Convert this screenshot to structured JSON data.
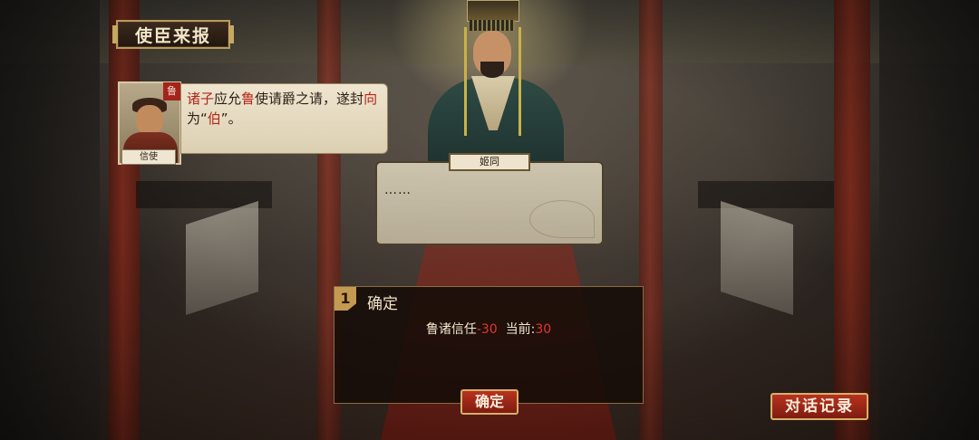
{
  "banner": {
    "title": "使臣来报"
  },
  "envoy": {
    "seal": "鲁",
    "name": "信使",
    "message": {
      "part1": "诸子",
      "part2": "应允",
      "part3": "鲁",
      "part4": "使请爵之请，遂封",
      "part5": "向",
      "part6": "为“",
      "part7": "伯",
      "part8": "”。"
    }
  },
  "king": {
    "name": "姬同",
    "dialogue": "……"
  },
  "choice": {
    "number": "1",
    "title": "确定",
    "effect_label": "鲁诸信任",
    "effect_value": "-30",
    "current_label": "当前:",
    "current_value": "30"
  },
  "buttons": {
    "confirm": "确定",
    "dialogue_log": "对话记录"
  }
}
